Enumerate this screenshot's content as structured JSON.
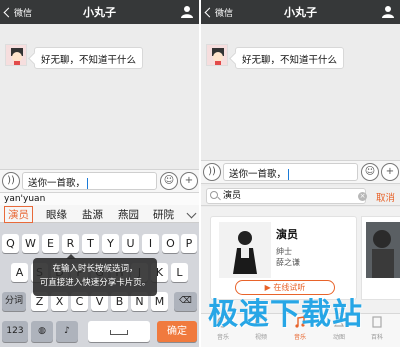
{
  "left": {
    "nav": {
      "back_label": "微信",
      "title": "小丸子"
    },
    "message": "好无聊，不知道干什么",
    "input": {
      "text": "送你一首歌，"
    },
    "keyboard": {
      "pinyin": "yan'yuan",
      "candidates": [
        "演员",
        "眼缘",
        "盐源",
        "燕园",
        "研院"
      ],
      "rows": [
        [
          "Q",
          "W",
          "E",
          "R",
          "T",
          "Y",
          "U",
          "I",
          "O",
          "P"
        ],
        [
          "A",
          "S",
          "D",
          "F",
          "G",
          "H",
          "J",
          "K",
          "L"
        ],
        [
          "Z",
          "X",
          "C",
          "V",
          "B",
          "N",
          "M"
        ]
      ],
      "split_label": "分词",
      "num_label": "123",
      "confirm_label": "确定"
    },
    "tooltip": {
      "line1": "在输入时长按候选词，",
      "line2": "可直接进入快速分享卡片页。"
    }
  },
  "right": {
    "nav": {
      "back_label": "微信",
      "title": "小丸子"
    },
    "message": "好无聊，不知道干什么",
    "input": {
      "text": "送你一首歌，"
    },
    "search": {
      "query": "演员",
      "cancel_label": "取消"
    },
    "song": {
      "title": "演员",
      "line1": "绅士",
      "line2": "薛之谦",
      "listen_label": "在线试听"
    },
    "tabs": [
      {
        "label": "音乐",
        "icon": "music-icon"
      },
      {
        "label": "视频",
        "icon": "video-icon"
      },
      {
        "label": "音乐",
        "icon": "music-note-icon",
        "active": true
      },
      {
        "label": "动图",
        "icon": "gif-icon"
      },
      {
        "label": "百科",
        "icon": "book-icon"
      }
    ]
  },
  "watermark": "极速下载站",
  "colors": {
    "accent": "#e8632a",
    "navbar": "#363839",
    "watermark": "#27a6e6"
  }
}
